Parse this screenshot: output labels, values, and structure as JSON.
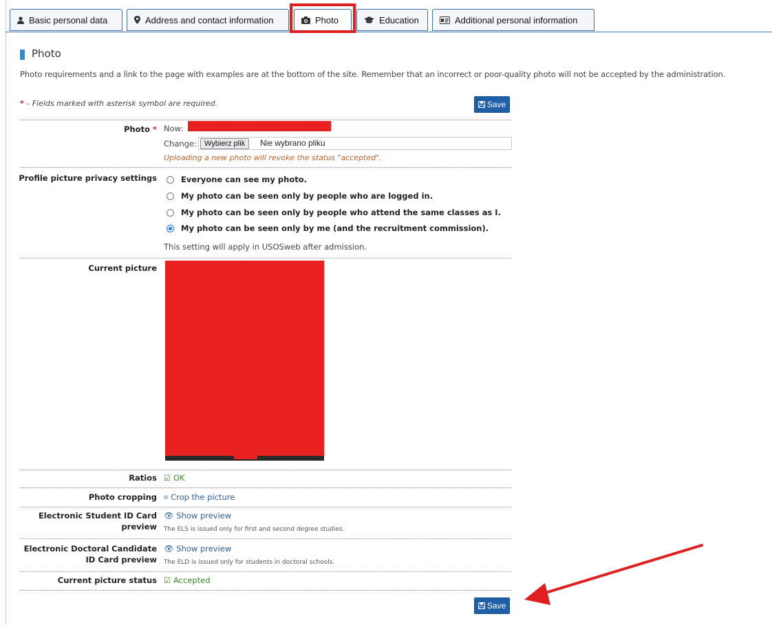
{
  "tabs": [
    {
      "label": "Basic personal data",
      "icon": "user-icon"
    },
    {
      "label": "Address and contact information",
      "icon": "map-marker-icon"
    },
    {
      "label": "Photo",
      "icon": "camera-icon"
    },
    {
      "label": "Education",
      "icon": "graduation-cap-icon"
    },
    {
      "label": "Additional personal information",
      "icon": "id-card-icon"
    }
  ],
  "section": {
    "title": "Photo",
    "intro": "Photo requirements and a link to the page with examples are at the bottom of the site. Remember that an incorrect or poor-quality photo will not be accepted by the administration.",
    "required_star": "*",
    "required_note": "– Fields marked with asterisk symbol are required.",
    "save_label": "Save"
  },
  "photo_field": {
    "label": "Photo",
    "star": "*",
    "now_label": "Now:",
    "change_label": "Change:",
    "file_button": "Wybierz plik",
    "file_none": "Nie wybrano pliku",
    "warning": "Uploading a new photo will revoke the status \"accepted\"."
  },
  "privacy": {
    "label": "Profile picture privacy settings",
    "options": [
      "Everyone can see my photo.",
      "My photo can be seen only by people who are logged in.",
      "My photo can be seen only by people who attend the same classes as I.",
      "My photo can be seen only by me (and the recruitment commission)."
    ],
    "selected_index": 3,
    "note": "This setting will apply in USOSweb after admission."
  },
  "current_picture": {
    "label": "Current picture"
  },
  "ratios": {
    "label": "Ratios",
    "value": "OK"
  },
  "cropping": {
    "label": "Photo cropping",
    "link": "Crop the picture"
  },
  "els": {
    "label_line1": "Electronic Student ID Card",
    "label_line2": "preview",
    "link": "Show preview",
    "note": "The ELS is issued only for first and second degree studies."
  },
  "eld": {
    "label_line1": "Electronic Doctoral Candidate",
    "label_line2": "ID Card preview",
    "link": "Show preview",
    "note": "The ELD is issued only for students in doctoral schools."
  },
  "status": {
    "label": "Current picture status",
    "value": "Accepted"
  },
  "colors": {
    "accent": "#1f5fa8",
    "highlight": "#e02020",
    "ok": "#3c8c2a",
    "link": "#2f5f9a",
    "redaction": "#e8201f"
  }
}
